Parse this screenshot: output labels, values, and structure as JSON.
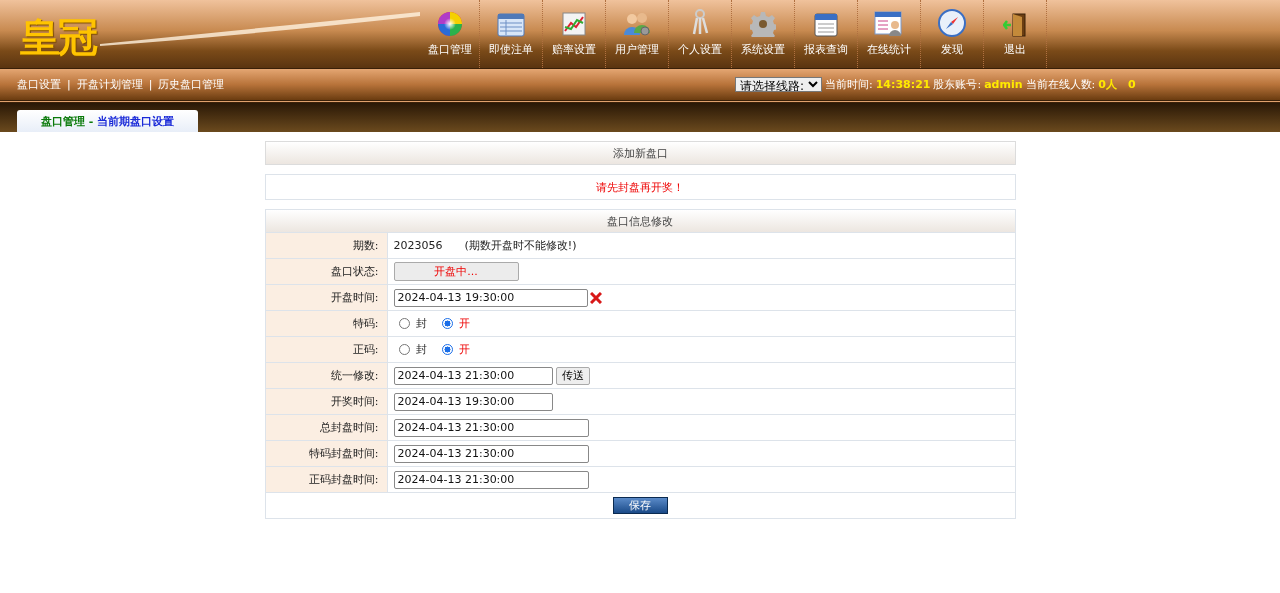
{
  "logo": "皇冠",
  "nav": [
    {
      "label": "盘口管理"
    },
    {
      "label": "即使注单"
    },
    {
      "label": "赔率设置"
    },
    {
      "label": "用户管理"
    },
    {
      "label": "个人设置"
    },
    {
      "label": "系统设置"
    },
    {
      "label": "报表查询"
    },
    {
      "label": "在线统计"
    },
    {
      "label": "发现"
    },
    {
      "label": "退出"
    }
  ],
  "subnav": {
    "items": [
      "盘口设置",
      "开盘计划管理",
      "历史盘口管理"
    ],
    "separator": "|"
  },
  "status": {
    "line_select": "请选择线路:",
    "time_label": "当前时间:",
    "time": "14:38:21",
    "account_label": "股东账号:",
    "account": "admin",
    "online_label": "当前在线人数:",
    "online": "0人",
    "extra": "0"
  },
  "tab": {
    "section": "盘口管理 -",
    "page": "当前期盘口设置",
    "selected": true
  },
  "add_bar": "添加新盘口",
  "notice": "请先封盘再开奖！",
  "form": {
    "title": "盘口信息修改",
    "rows": [
      {
        "kind": "text",
        "label": "期数:",
        "value": "2023056",
        "note": "(期数开盘时不能修改!)"
      },
      {
        "kind": "status",
        "label": "盘口状态:",
        "button": "开盘中..."
      },
      {
        "kind": "clearable",
        "label": "开盘时间:",
        "value": "2024-04-13 19:30:00"
      },
      {
        "kind": "radio",
        "label": "特码:",
        "options": [
          {
            "label": "封",
            "selected": false
          },
          {
            "label": "开",
            "selected": true
          }
        ]
      },
      {
        "kind": "radio",
        "label": "正码:",
        "options": [
          {
            "label": "封",
            "selected": false
          },
          {
            "label": "开",
            "selected": true
          }
        ]
      },
      {
        "kind": "send",
        "label": "统一修改:",
        "value": "2024-04-13 21:30:00",
        "button": "传送"
      },
      {
        "kind": "short",
        "label": "开奖时间:",
        "value": "2024-04-13 19:30:00"
      },
      {
        "kind": "input",
        "label": "总封盘时间:",
        "value": "2024-04-13 21:30:00"
      },
      {
        "kind": "input",
        "label": "特码封盘时间:",
        "value": "2024-04-13 21:30:00"
      },
      {
        "kind": "input",
        "label": "正码封盘时间:",
        "value": "2024-04-13 21:30:00"
      }
    ],
    "save": "保存"
  }
}
